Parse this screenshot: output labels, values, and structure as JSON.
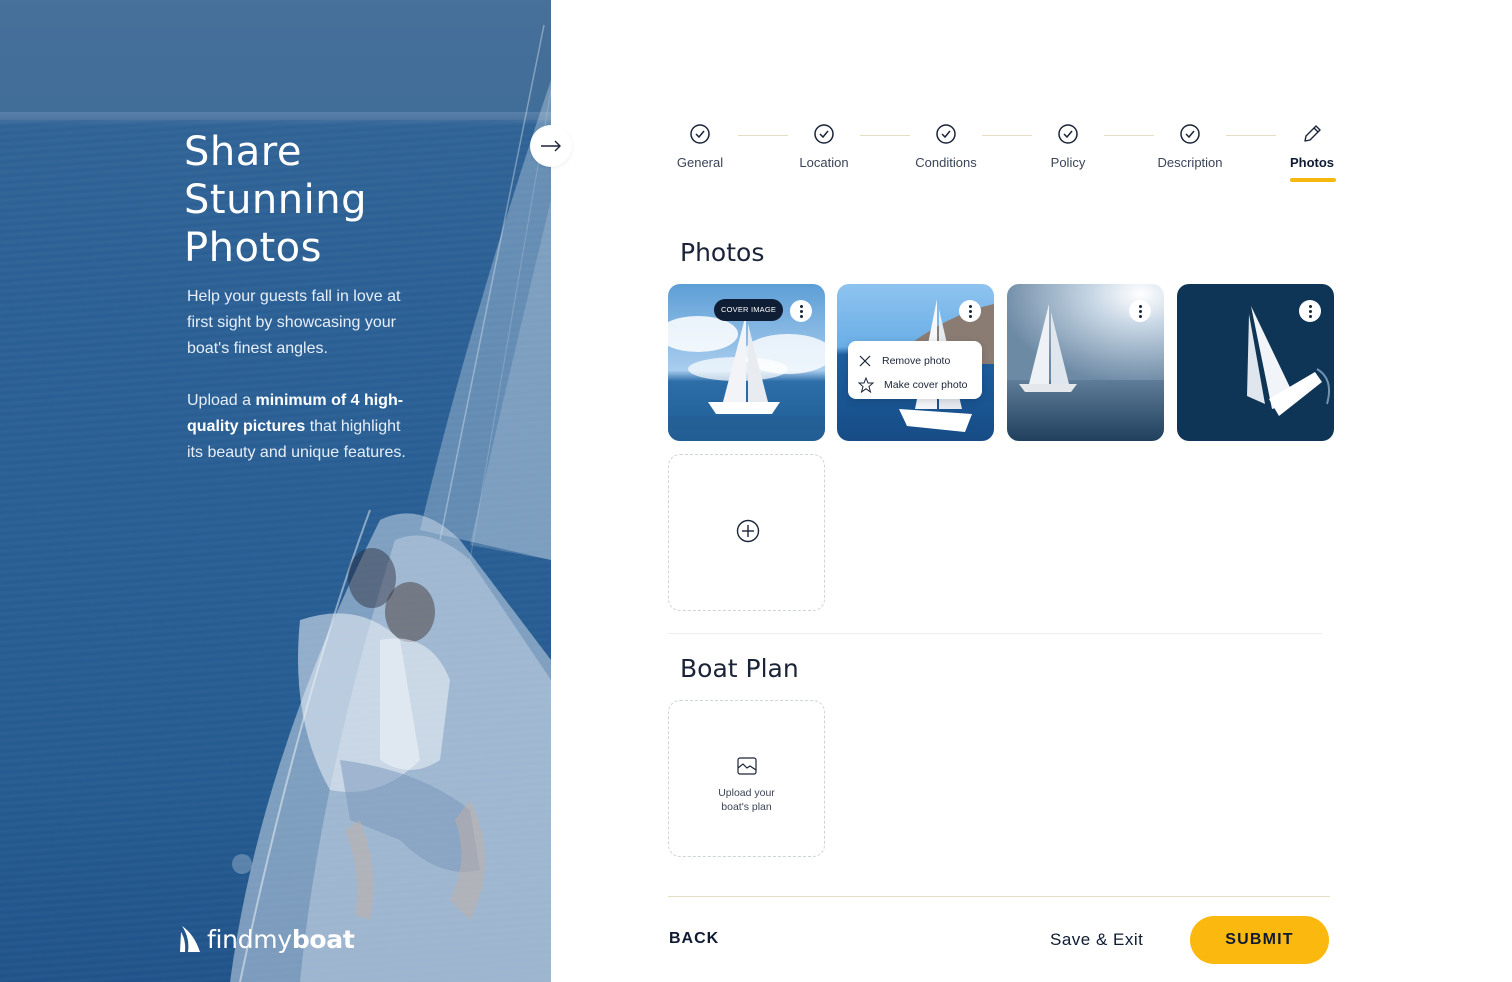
{
  "hero": {
    "title_lines": [
      "Share",
      "Stunning",
      "Photos"
    ],
    "paragraph1": "Help your guests fall in love at first sight by showcasing your boat's finest angles.",
    "paragraph2_pre": "Upload a ",
    "paragraph2_bold": "minimum of 4 high-quality pictures",
    "paragraph2_post": " that highlight its beauty and unique features."
  },
  "brand": {
    "part1": "findmy",
    "part2": "boat"
  },
  "collapse_icon": "arrow-right-icon",
  "stepper": {
    "steps": [
      {
        "label": "General",
        "state": "done",
        "icon": "check-circle-icon"
      },
      {
        "label": "Location",
        "state": "done",
        "icon": "check-circle-icon"
      },
      {
        "label": "Conditions",
        "state": "done",
        "icon": "check-circle-icon"
      },
      {
        "label": "Policy",
        "state": "done",
        "icon": "check-circle-icon"
      },
      {
        "label": "Description",
        "state": "done",
        "icon": "check-circle-icon"
      },
      {
        "label": "Photos",
        "state": "active",
        "icon": "pencil-icon"
      }
    ]
  },
  "photos": {
    "title": "Photos",
    "cover_badge": "COVER IMAGE",
    "items": [
      {
        "alt": "sailboat under cloudy sky",
        "cover": true
      },
      {
        "alt": "sailboat near rocky coast",
        "cover": false
      },
      {
        "alt": "sailboat sailing toward sun",
        "cover": false
      },
      {
        "alt": "aerial view of sailboat",
        "cover": false
      }
    ],
    "menu": {
      "remove": "Remove photo",
      "make_cover": "Make cover photo"
    }
  },
  "boat_plan": {
    "title": "Boat Plan",
    "upload_line1": "Upload your",
    "upload_line2": "boat's plan"
  },
  "footer": {
    "back": "BACK",
    "save_exit": "Save & Exit",
    "submit": "SUBMIT"
  },
  "colors": {
    "accent": "#fbb90f",
    "navy": "#0f1b33",
    "panel_blue": "#2a5f94"
  }
}
